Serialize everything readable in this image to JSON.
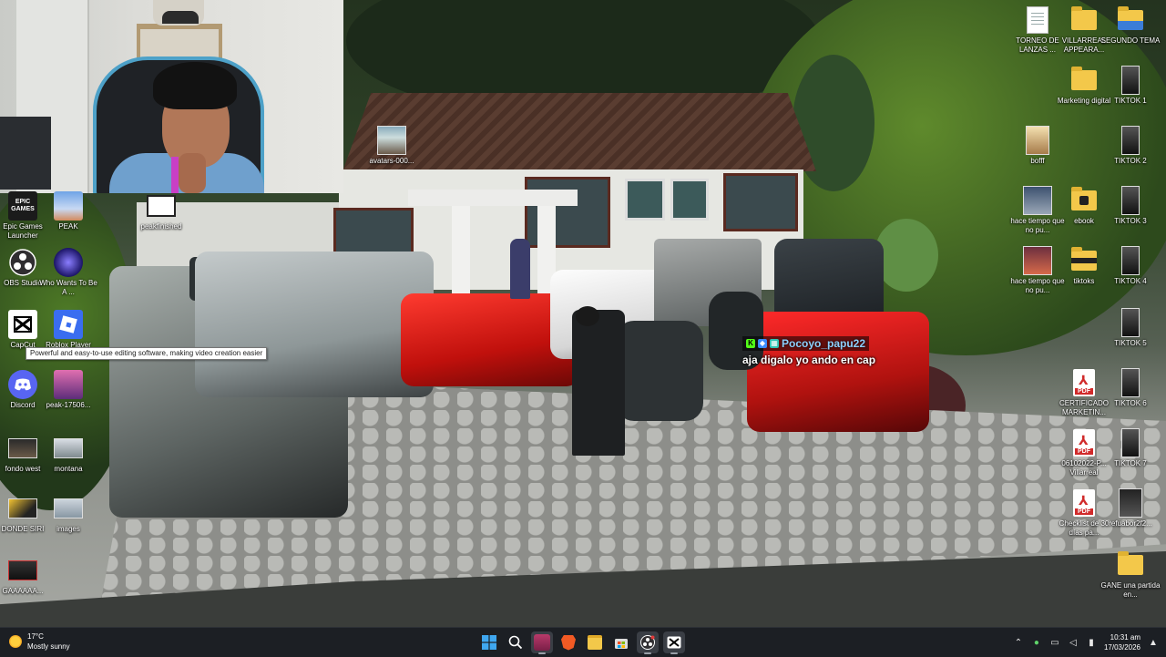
{
  "desktop": {
    "icons": [
      {
        "label": "Epic Games Launcher",
        "icon": "epic-games-icon"
      },
      {
        "label": "PEAK",
        "icon": "peak-game-icon"
      },
      {
        "label": "peakfinished",
        "icon": "video-thumbnail-icon"
      },
      {
        "label": "avatars-000...",
        "icon": "image-thumbnail-icon"
      },
      {
        "label": "OBS Studio",
        "icon": "obs-studio-icon"
      },
      {
        "label": "Who Wants To Be A ...",
        "icon": "game-icon"
      },
      {
        "label": "CapCut",
        "icon": "capcut-icon"
      },
      {
        "label": "Roblox Player",
        "icon": "roblox-icon"
      },
      {
        "label": "Discord",
        "icon": "discord-icon"
      },
      {
        "label": "peak-17506...",
        "icon": "image-thumbnail-icon"
      },
      {
        "label": "fondo west",
        "icon": "image-thumbnail-icon"
      },
      {
        "label": "montana",
        "icon": "image-thumbnail-icon"
      },
      {
        "label": "DONDE SIRI",
        "icon": "image-thumbnail-icon"
      },
      {
        "label": "images",
        "icon": "image-thumbnail-icon"
      },
      {
        "label": "GAAAAAA...",
        "icon": "image-thumbnail-icon"
      },
      {
        "label": "TORNEO DE LANZAS ...",
        "icon": "document-icon"
      },
      {
        "label": "VILLARREAL APPEARA...",
        "icon": "folder-icon"
      },
      {
        "label": "SEGUNDO TEMA",
        "icon": "folder-icon"
      },
      {
        "label": "Marketing digital",
        "icon": "folder-icon"
      },
      {
        "label": "TIKTOK 1",
        "icon": "tiktok-thumbnail-icon"
      },
      {
        "label": "bofff",
        "icon": "image-thumbnail-icon"
      },
      {
        "label": "TIKTOK 2",
        "icon": "tiktok-thumbnail-icon"
      },
      {
        "label": "hace tiempo que no pu...",
        "icon": "image-thumbnail-icon"
      },
      {
        "label": "ebook",
        "icon": "folder-icon"
      },
      {
        "label": "TIKTOK 3",
        "icon": "tiktok-thumbnail-icon"
      },
      {
        "label": "hace tiempo que no pu...",
        "icon": "image-thumbnail-icon"
      },
      {
        "label": "tiktoks",
        "icon": "folder-icon"
      },
      {
        "label": "TIKTOK 4",
        "icon": "tiktok-thumbnail-icon"
      },
      {
        "label": "TIKTOK 5",
        "icon": "tiktok-thumbnail-icon"
      },
      {
        "label": "CERTIFICADO MARKETIN...",
        "icon": "pdf-icon"
      },
      {
        "label": "TIKTOK 6",
        "icon": "tiktok-thumbnail-icon"
      },
      {
        "label": "06102022-P... Villarreal",
        "icon": "pdf-icon"
      },
      {
        "label": "TIKTOK 7",
        "icon": "tiktok-thumbnail-icon"
      },
      {
        "label": "Checklist de 30 días pa...",
        "icon": "pdf-icon"
      },
      {
        "label": "refuabor2f2...",
        "icon": "image-thumbnail-icon"
      },
      {
        "label": "GANE una partida en...",
        "icon": "folder-icon"
      }
    ],
    "tooltip": "Powerful and easy-to-use editing software, making video creation easier"
  },
  "chat": {
    "username": "Pocoyo_papu22",
    "message": "aja digalo yo ando en cap",
    "badge_colors": [
      "#53fc18",
      "#3a8bff",
      "#2ec4b6"
    ]
  },
  "taskbar": {
    "weather": {
      "temp": "17°C",
      "condition": "Mostly sunny"
    },
    "apps": [
      "start-icon",
      "search-icon",
      "pinned-app-icon",
      "brave-browser-icon",
      "file-explorer-icon",
      "microsoft-store-icon",
      "obs-taskbar-icon",
      "capcut-taskbar-icon"
    ],
    "clock": {
      "time": "10:31 am",
      "date": "17/03/2026"
    }
  },
  "colors": {
    "taskbar_bg": "#1c1f24",
    "folder": "#f3c84a",
    "pdf_red": "#d12b2b",
    "chat_name": "#8fd0ff"
  }
}
